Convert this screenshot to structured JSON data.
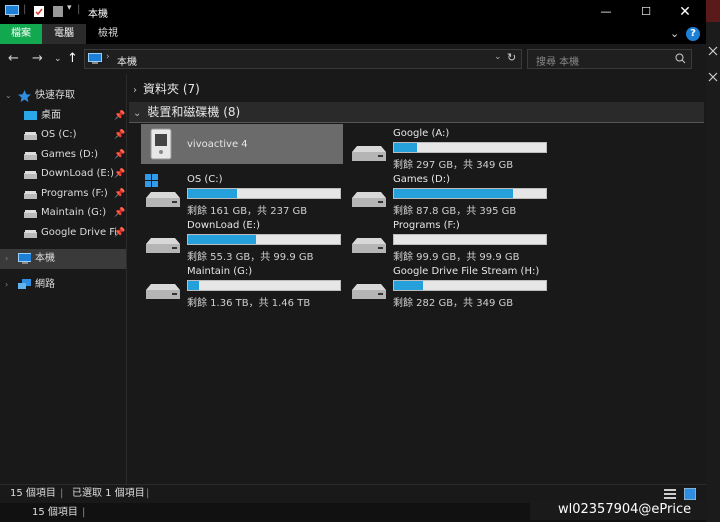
{
  "window": {
    "title": "本機",
    "controls": [
      "minimize-icon",
      "maximize-icon",
      "close-icon"
    ]
  },
  "ribbon": {
    "tabs": [
      "檔案",
      "電腦",
      "檢視"
    ],
    "help": "?"
  },
  "address": {
    "path": "本機",
    "search_placeholder": "搜尋 本機"
  },
  "nav": {
    "quick_access": "快速存取",
    "items": [
      {
        "label": "桌面",
        "icon": "desktop-icon"
      },
      {
        "label": "OS (C:)",
        "icon": "drive-icon"
      },
      {
        "label": "Games (D:)",
        "icon": "drive-icon"
      },
      {
        "label": "DownLoad (E:)",
        "icon": "drive-icon"
      },
      {
        "label": "Programs (F:)",
        "icon": "drive-icon"
      },
      {
        "label": "Maintain (G:)",
        "icon": "drive-icon"
      },
      {
        "label": "Google Drive Fi",
        "icon": "drive-icon"
      }
    ],
    "this_pc": "本機",
    "network": "網路"
  },
  "groups": {
    "folders": "資料夾 (7)",
    "devices": "裝置和磁碟機 (8)"
  },
  "device": {
    "name": "vivoactive 4",
    "icon": "device-icon"
  },
  "drives": [
    {
      "name": "Google (A:)",
      "free": "剩餘 297 GB，共 349 GB",
      "used": 0.15
    },
    {
      "name": "OS (C:)",
      "free": "剩餘 161 GB，共 237 GB",
      "used": 0.32,
      "icon": "windows-icon"
    },
    {
      "name": "Games (D:)",
      "free": "剩餘 87.8 GB，共 395 GB",
      "used": 0.78
    },
    {
      "name": "DownLoad (E:)",
      "free": "剩餘 55.3 GB，共 99.9 GB",
      "used": 0.45
    },
    {
      "name": "Programs (F:)",
      "free": "剩餘 99.9 GB，共 99.9 GB",
      "used": 0.0
    },
    {
      "name": "Maintain (G:)",
      "free": "剩餘 1.36 TB，共 1.46 TB",
      "used": 0.07
    },
    {
      "name": "Google Drive File Stream (H:)",
      "free": "剩餘 282 GB，共 349 GB",
      "used": 0.19
    }
  ],
  "status": {
    "count": "15 個項目",
    "selected": "已選取 1 個項目",
    "count2": "15 個項目"
  },
  "watermark": "wl02357904@ePrice",
  "colors": {
    "accent": "#11a84f",
    "bar_fill": "#26a0da"
  }
}
